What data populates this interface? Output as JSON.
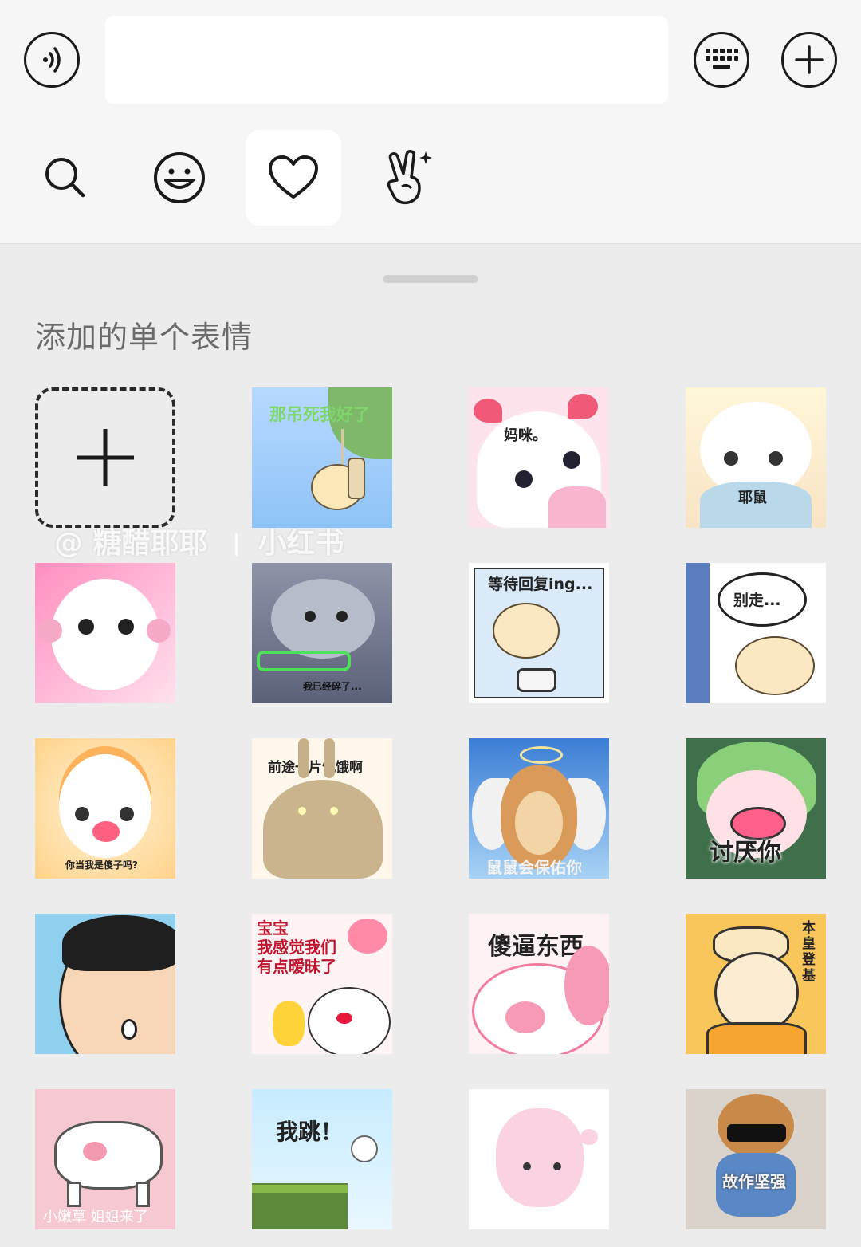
{
  "input": {
    "value": ""
  },
  "tabs": [
    {
      "name": "search-icon",
      "active": false
    },
    {
      "name": "emoji-icon",
      "active": false
    },
    {
      "name": "heart-icon",
      "active": true
    },
    {
      "name": "sparkle-hand-icon",
      "active": false
    }
  ],
  "panel": {
    "section_title": "添加的单个表情"
  },
  "stickers": [
    {
      "caption": ""
    },
    {
      "caption": "那吊死我好了"
    },
    {
      "caption": "妈咪。"
    },
    {
      "caption": "耶鼠"
    },
    {
      "caption": ""
    },
    {
      "caption": "我已经碎了..."
    },
    {
      "caption": "等待回复ing..."
    },
    {
      "caption": "别走..."
    },
    {
      "caption": "你当我是傻子吗?"
    },
    {
      "caption": "前途一片饥饿啊"
    },
    {
      "caption": "鼠鼠会保佑你"
    },
    {
      "caption": "讨厌你"
    },
    {
      "caption": ""
    },
    {
      "caption": "宝宝\n我感觉我们\n有点暧昧了"
    },
    {
      "caption": "傻逼东西"
    },
    {
      "caption": "本皇登基"
    },
    {
      "caption": "小嫩草 姐姐来了"
    },
    {
      "caption": "我跳！"
    },
    {
      "caption": ""
    },
    {
      "caption": "故作坚强"
    }
  ],
  "watermark": {
    "user": "@ 糖醋耶耶",
    "brand": "小红书"
  }
}
